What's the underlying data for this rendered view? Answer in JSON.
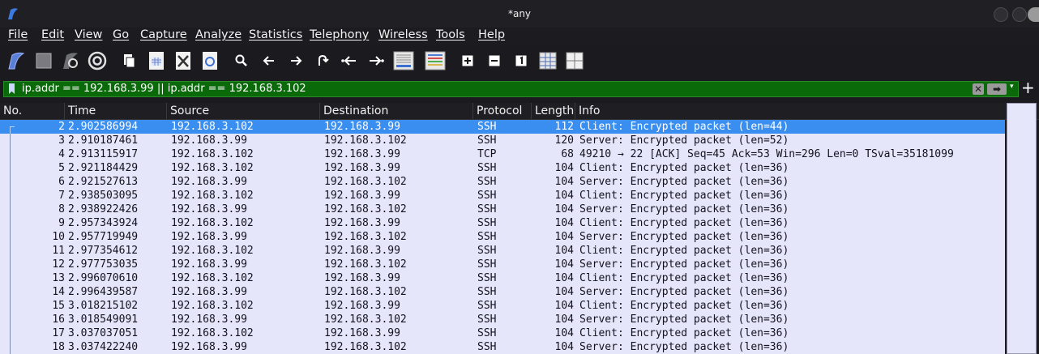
{
  "window": {
    "title": "*any"
  },
  "menu": [
    "File",
    "Edit",
    "View",
    "Go",
    "Capture",
    "Analyze",
    "Statistics",
    "Telephony",
    "Wireless",
    "Tools",
    "Help"
  ],
  "toolbar": {
    "icons": [
      "start-capture-icon",
      "stop-capture-icon",
      "restart-capture-icon",
      "capture-options-icon",
      "open-file-icon",
      "save-file-icon",
      "close-file-icon",
      "reload-file-icon",
      "find-packet-icon",
      "go-back-icon",
      "go-forward-icon",
      "go-to-packet-icon",
      "go-first-packet-icon",
      "go-last-packet-icon",
      "auto-scroll-icon",
      "colorize-icon",
      "zoom-in-icon",
      "zoom-out-icon",
      "normal-size-icon",
      "resize-columns-icon",
      "layout-icon"
    ]
  },
  "filter": {
    "value": "ip.addr == 192.168.3.99 || ip.addr == 192.168.3.102",
    "clear_glyph": "✕",
    "apply_glyph": "➡",
    "dropdown_glyph": "▾",
    "add_glyph": "+",
    "field_color": "#0a6a0a"
  },
  "columns": {
    "no": "No.",
    "time": "Time",
    "source": "Source",
    "destination": "Destination",
    "protocol": "Protocol",
    "length": "Length",
    "info": "Info"
  },
  "colors": {
    "row_bg": "#e6e6fa",
    "selected_bg": "#3a8ef0"
  },
  "packets": [
    {
      "no": "2",
      "time": "2.902586994",
      "src": "192.168.3.102",
      "dst": "192.168.3.99",
      "proto": "SSH",
      "len": "112",
      "info": "Client: Encrypted packet (len=44)",
      "selected": true
    },
    {
      "no": "3",
      "time": "2.910187461",
      "src": "192.168.3.99",
      "dst": "192.168.3.102",
      "proto": "SSH",
      "len": "120",
      "info": "Server: Encrypted packet (len=52)"
    },
    {
      "no": "4",
      "time": "2.913115917",
      "src": "192.168.3.102",
      "dst": "192.168.3.99",
      "proto": "TCP",
      "len": "68",
      "info": "49210 → 22 [ACK] Seq=45 Ack=53 Win=296 Len=0 TSval=35181099"
    },
    {
      "no": "5",
      "time": "2.921184429",
      "src": "192.168.3.102",
      "dst": "192.168.3.99",
      "proto": "SSH",
      "len": "104",
      "info": "Client: Encrypted packet (len=36)"
    },
    {
      "no": "6",
      "time": "2.921527613",
      "src": "192.168.3.99",
      "dst": "192.168.3.102",
      "proto": "SSH",
      "len": "104",
      "info": "Server: Encrypted packet (len=36)"
    },
    {
      "no": "7",
      "time": "2.938503095",
      "src": "192.168.3.102",
      "dst": "192.168.3.99",
      "proto": "SSH",
      "len": "104",
      "info": "Client: Encrypted packet (len=36)"
    },
    {
      "no": "8",
      "time": "2.938922426",
      "src": "192.168.3.99",
      "dst": "192.168.3.102",
      "proto": "SSH",
      "len": "104",
      "info": "Server: Encrypted packet (len=36)"
    },
    {
      "no": "9",
      "time": "2.957343924",
      "src": "192.168.3.102",
      "dst": "192.168.3.99",
      "proto": "SSH",
      "len": "104",
      "info": "Client: Encrypted packet (len=36)"
    },
    {
      "no": "10",
      "time": "2.957719949",
      "src": "192.168.3.99",
      "dst": "192.168.3.102",
      "proto": "SSH",
      "len": "104",
      "info": "Server: Encrypted packet (len=36)"
    },
    {
      "no": "11",
      "time": "2.977354612",
      "src": "192.168.3.102",
      "dst": "192.168.3.99",
      "proto": "SSH",
      "len": "104",
      "info": "Client: Encrypted packet (len=36)"
    },
    {
      "no": "12",
      "time": "2.977753035",
      "src": "192.168.3.99",
      "dst": "192.168.3.102",
      "proto": "SSH",
      "len": "104",
      "info": "Server: Encrypted packet (len=36)"
    },
    {
      "no": "13",
      "time": "2.996070610",
      "src": "192.168.3.102",
      "dst": "192.168.3.99",
      "proto": "SSH",
      "len": "104",
      "info": "Client: Encrypted packet (len=36)"
    },
    {
      "no": "14",
      "time": "2.996439587",
      "src": "192.168.3.99",
      "dst": "192.168.3.102",
      "proto": "SSH",
      "len": "104",
      "info": "Server: Encrypted packet (len=36)"
    },
    {
      "no": "15",
      "time": "3.018215102",
      "src": "192.168.3.102",
      "dst": "192.168.3.99",
      "proto": "SSH",
      "len": "104",
      "info": "Client: Encrypted packet (len=36)"
    },
    {
      "no": "16",
      "time": "3.018549091",
      "src": "192.168.3.99",
      "dst": "192.168.3.102",
      "proto": "SSH",
      "len": "104",
      "info": "Server: Encrypted packet (len=36)"
    },
    {
      "no": "17",
      "time": "3.037037051",
      "src": "192.168.3.102",
      "dst": "192.168.3.99",
      "proto": "SSH",
      "len": "104",
      "info": "Client: Encrypted packet (len=36)"
    },
    {
      "no": "18",
      "time": "3.037422240",
      "src": "192.168.3.99",
      "dst": "192.168.3.102",
      "proto": "SSH",
      "len": "104",
      "info": "Server: Encrypted packet (len=36)"
    }
  ]
}
